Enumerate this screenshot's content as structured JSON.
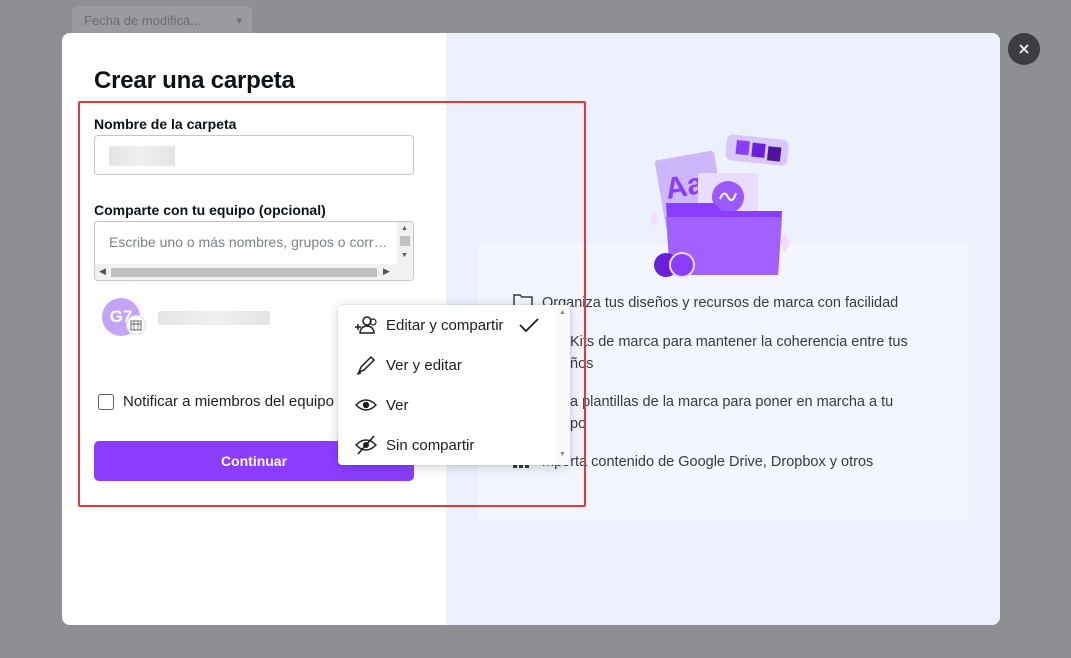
{
  "background": {
    "tab_label": "Fecha de modifica..."
  },
  "dialog": {
    "title": "Crear una carpeta",
    "folder_name_label": "Nombre de la carpeta",
    "folder_name_value": "",
    "share_label": "Comparte con tu equipo (opcional)",
    "share_placeholder": "Escribe uno o más nombres, grupos o correos",
    "avatar_initials": "G7",
    "notify_label": "Notificar a miembros del equipo",
    "notify_checked": false,
    "continue_label": "Continuar"
  },
  "permission_menu": {
    "items": [
      {
        "label": "Editar y compartir",
        "icon": "add-person-icon",
        "selected": true
      },
      {
        "label": "Ver y editar",
        "icon": "pencil-icon",
        "selected": false
      },
      {
        "label": "Ver",
        "icon": "eye-icon",
        "selected": false
      },
      {
        "label": "Sin compartir",
        "icon": "eye-off-icon",
        "selected": false
      }
    ]
  },
  "features": [
    {
      "icon": "folder-icon",
      "lines": [
        "Organiza tus diseños y recursos de marca con facilidad"
      ]
    },
    {
      "icon": "brand-kit-icon",
      "lines": [
        "Kits de marca para mantener la coherencia entre tus",
        "ños"
      ]
    },
    {
      "icon": "template-icon",
      "lines": [
        "a plantillas de la marca para poner en marcha a tu",
        "po"
      ]
    },
    {
      "icon": "apps-icon",
      "lines": [
        "mporta contenido de Google Drive, Dropbox y otros"
      ]
    }
  ],
  "colors": {
    "accent": "#8b3dff",
    "highlight": "#e53935",
    "right_panel": "#ecf1fd",
    "overlay": "#8e8f92"
  }
}
